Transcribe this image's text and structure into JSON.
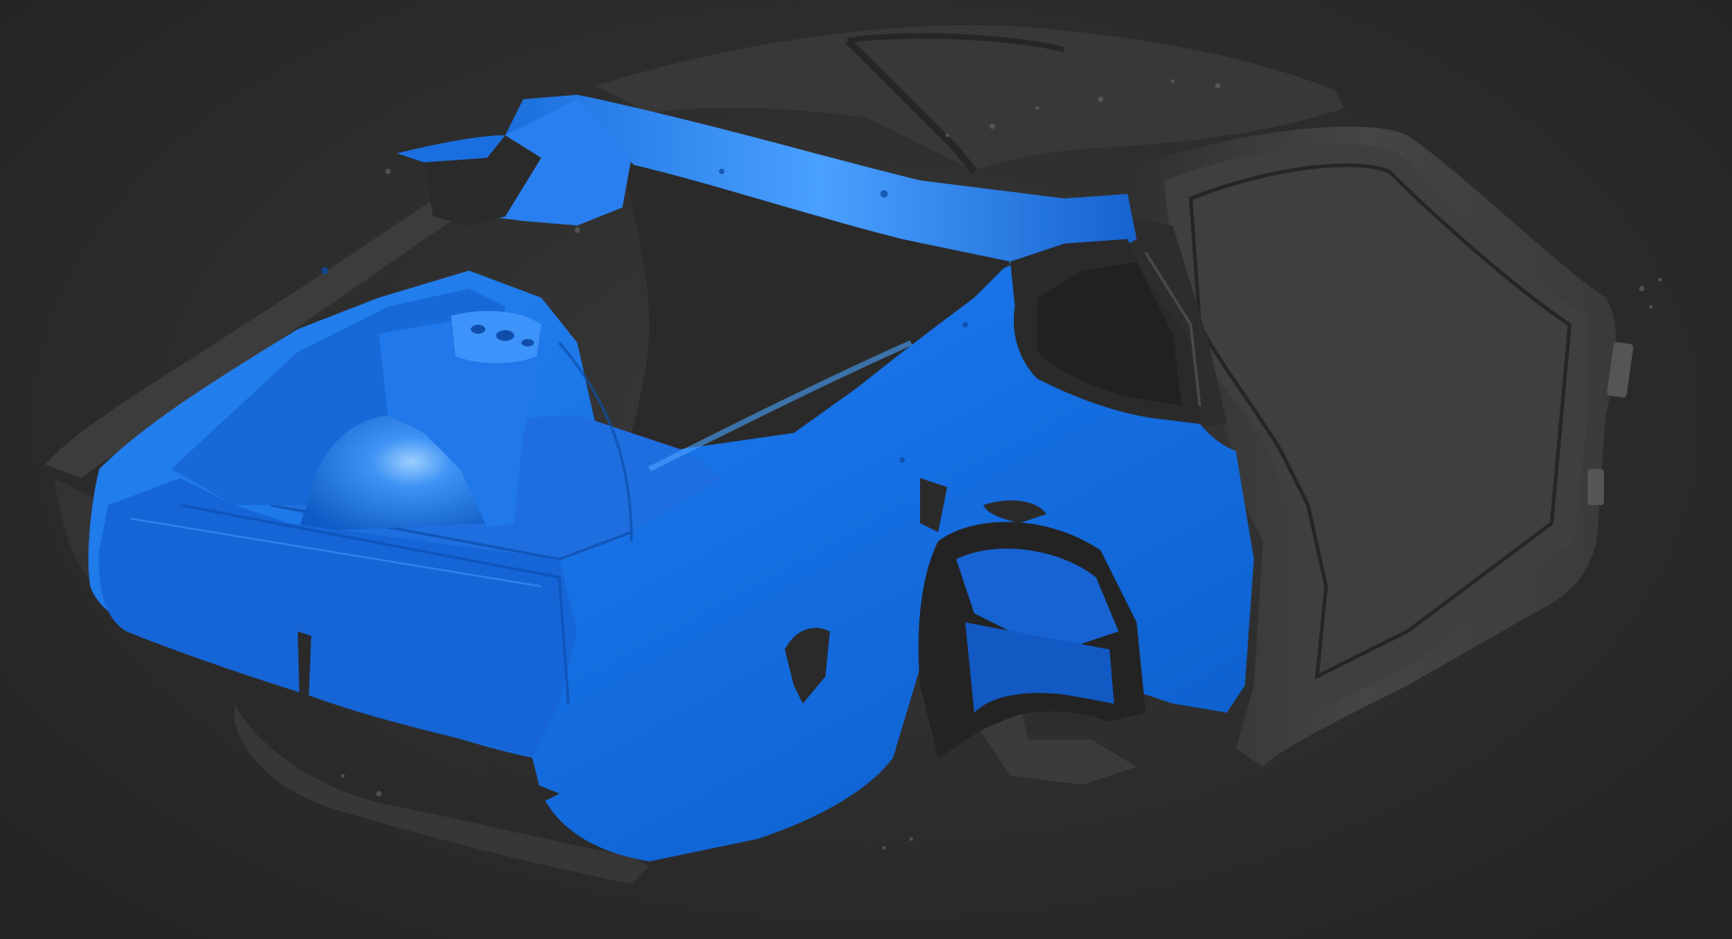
{
  "viewport": {
    "background": "#2b2b2b",
    "highlight_color": "#1a72e6",
    "scan_color": "#3c3c3c"
  },
  "model": {
    "icon": "car-body-scan-icon"
  }
}
